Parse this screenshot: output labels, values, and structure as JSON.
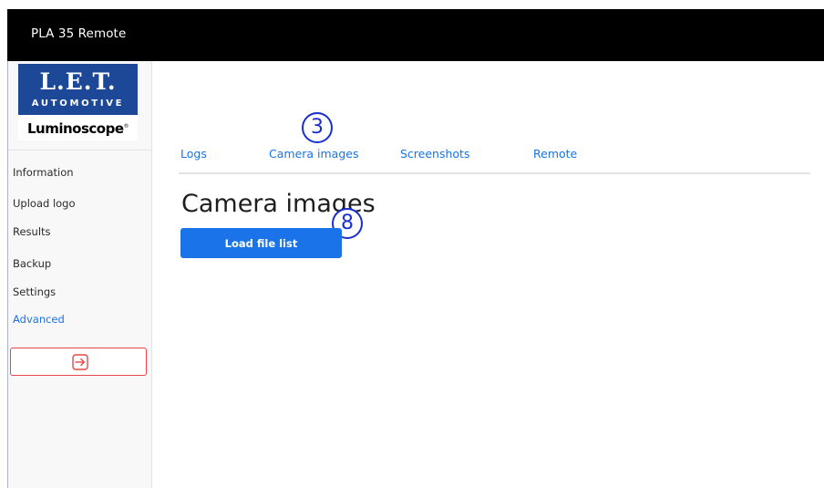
{
  "app": {
    "title": "PLA 35 Remote"
  },
  "logo": {
    "main": "L.E.T.",
    "sub": "AUTOMOTIVE",
    "product": "Luminoscope",
    "reg": "®"
  },
  "sidebar": {
    "items": [
      {
        "label": "Information",
        "active": false
      },
      {
        "label": "Upload logo",
        "active": false
      },
      {
        "label": "Results",
        "active": false
      },
      {
        "label": "Backup",
        "active": false
      },
      {
        "label": "Settings",
        "active": false
      },
      {
        "label": "Advanced",
        "active": true
      }
    ],
    "logout_icon": "logout-arrow-icon"
  },
  "tabs": [
    {
      "label": "Logs"
    },
    {
      "label": "Camera images"
    },
    {
      "label": "Screenshots"
    },
    {
      "label": "Remote"
    }
  ],
  "main": {
    "heading": "Camera images",
    "load_button": "Load file list"
  },
  "annotations": [
    {
      "label": "3"
    },
    {
      "label": "8"
    }
  ],
  "colors": {
    "accent": "#1a73e8",
    "topbar": "#000000",
    "logo_blue": "#1c4897",
    "logout_border": "#e54848",
    "marker": "#1a2fd0"
  }
}
